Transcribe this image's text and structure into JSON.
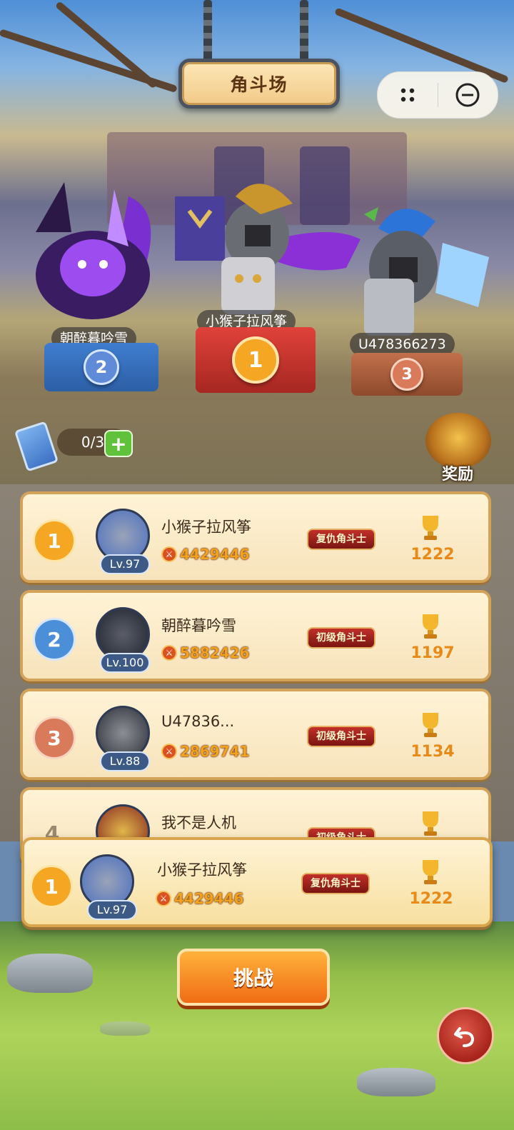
{
  "title": "角斗场",
  "capsule": {
    "menu_icon": "more-dots-icon",
    "close_icon": "minimize-circle-icon"
  },
  "podium": [
    {
      "place": "1",
      "name": "小猴子拉风筝"
    },
    {
      "place": "2",
      "name": "朝醉暮吟雪"
    },
    {
      "place": "3",
      "name": "U478366273"
    }
  ],
  "tickets": {
    "count": "0/3",
    "add_icon": "plus-icon"
  },
  "reward": {
    "label": "奖励"
  },
  "leaderboard": [
    {
      "rank": "1",
      "name": "小猴子拉风筝",
      "level": "Lv.97",
      "power": "4429446",
      "title": "复仇角斗士",
      "trophies": "1222"
    },
    {
      "rank": "2",
      "name": "朝醉暮吟雪",
      "level": "Lv.100",
      "power": "5882426",
      "title": "初级角斗士",
      "trophies": "1197"
    },
    {
      "rank": "3",
      "name": "U47836...",
      "level": "Lv.88",
      "power": "2869741",
      "title": "初级角斗士",
      "trophies": "1134"
    },
    {
      "rank": "4",
      "name": "我不是人机",
      "level": "",
      "power": "",
      "title": "初级角斗士",
      "trophies": ""
    }
  ],
  "self": {
    "rank": "1",
    "name": "小猴子拉风筝",
    "level": "Lv.97",
    "power": "4429446",
    "title": "复仇角斗士",
    "trophies": "1222"
  },
  "challenge": {
    "label": "挑战"
  },
  "colors": {
    "gold": "#f2a21c",
    "orange": "#f06c15",
    "rank1": "#f5a623",
    "rank2": "#4a8fd8",
    "rank3": "#d97a5a"
  }
}
